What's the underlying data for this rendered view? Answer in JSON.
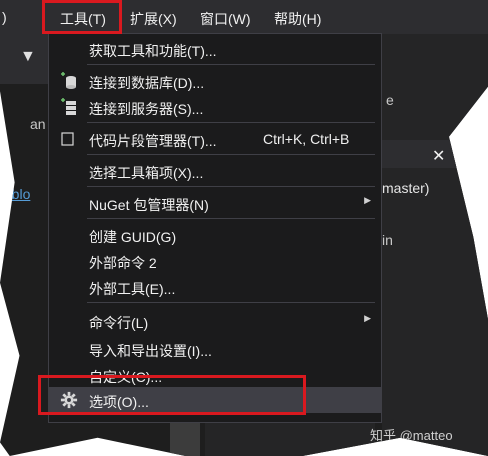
{
  "menubar": {
    "prefix": ")",
    "items": [
      "工具(T)",
      "扩展(X)",
      "窗口(W)",
      "帮助(H)"
    ]
  },
  "background": {
    "code_fragment": "an",
    "link_fragment": "e/blo",
    "branch_fragment": "master)",
    "panel_fragment": "in",
    "panel_letter": "e"
  },
  "tools_menu": {
    "items": [
      {
        "label": "获取工具和功能(T)...",
        "icon": "none"
      },
      {
        "label": "连接到数据库(D)...",
        "icon": "database-connect-icon"
      },
      {
        "label": "连接到服务器(S)...",
        "icon": "server-connect-icon"
      },
      {
        "label": "代码片段管理器(T)...",
        "icon": "checkbox-icon",
        "shortcut": "Ctrl+K, Ctrl+B"
      },
      {
        "label": "选择工具箱项(X)...",
        "icon": "none"
      },
      {
        "label": "NuGet 包管理器(N)",
        "icon": "none",
        "submenu": true
      },
      {
        "label": "创建 GUID(G)",
        "icon": "none"
      },
      {
        "label": "外部命令 2",
        "icon": "none"
      },
      {
        "label": "外部工具(E)...",
        "icon": "none"
      },
      {
        "label": "命令行(L)",
        "icon": "none",
        "submenu": true
      },
      {
        "label": "导入和导出设置(I)...",
        "icon": "none"
      },
      {
        "label": "自定义(C)...",
        "icon": "none"
      },
      {
        "label": "选项(O)...",
        "icon": "gear-icon",
        "highlighted": true
      }
    ]
  },
  "watermark": "知乎 @matteo",
  "colors": {
    "highlight_box": "#d9191f",
    "menu_bg": "#1b1b1c",
    "menubar_bg": "#2d2d30",
    "link": "#569cd6"
  }
}
